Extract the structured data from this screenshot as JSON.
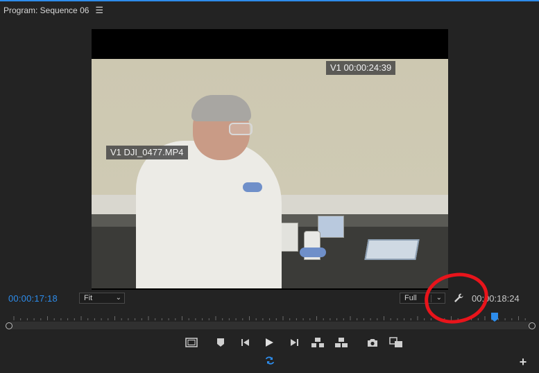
{
  "panel": {
    "title": "Program: Sequence 06",
    "menu_icon": "hamburger-menu-icon"
  },
  "viewer": {
    "timecode_overlay": "V1 00:00:24:39",
    "clip_overlay": "V1 DJI_0477.MP4"
  },
  "status_bar": {
    "current_timecode": "00:00:17:18",
    "zoom_select": "Fit",
    "resolution_select": "Full",
    "settings_icon": "wrench-icon",
    "duration_timecode": "00:00:18:24"
  },
  "timeline": {
    "playhead_position_fraction": 0.93
  },
  "transport": [
    {
      "name": "safe-margins-button",
      "icon": "safe-margins-icon"
    },
    {
      "name": "add-marker-button",
      "icon": "marker-icon"
    },
    {
      "name": "step-back-button",
      "icon": "step-back-icon"
    },
    {
      "name": "play-button",
      "icon": "play-icon"
    },
    {
      "name": "step-forward-button",
      "icon": "step-forward-icon"
    },
    {
      "name": "lift-button",
      "icon": "lift-icon"
    },
    {
      "name": "extract-button",
      "icon": "extract-icon"
    },
    {
      "name": "export-frame-button",
      "icon": "camera-icon"
    },
    {
      "name": "comparison-view-button",
      "icon": "comparison-view-icon"
    }
  ],
  "extra": {
    "loop_icon": "loop-playback-icon",
    "add_icon": "plus-icon",
    "add_glyph": "+"
  },
  "colors": {
    "accent": "#2d8ceb",
    "annotation": "#e8141b",
    "background": "#232323"
  }
}
